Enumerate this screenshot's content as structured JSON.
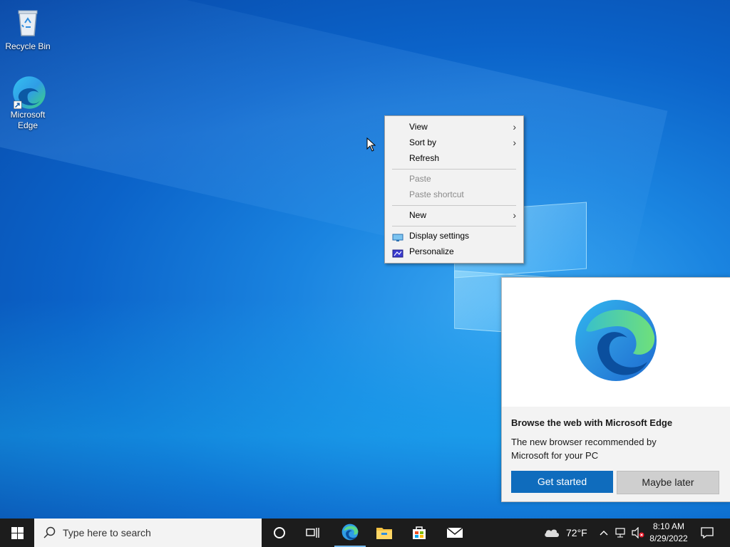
{
  "desktop": {
    "icons": [
      {
        "label": "Recycle Bin"
      },
      {
        "label": "Microsoft Edge"
      }
    ]
  },
  "context_menu": {
    "items": [
      {
        "label": "View",
        "has_submenu": true,
        "enabled": true
      },
      {
        "label": "Sort by",
        "has_submenu": true,
        "enabled": true
      },
      {
        "label": "Refresh",
        "enabled": true
      },
      {
        "label": "Paste",
        "enabled": false
      },
      {
        "label": "Paste shortcut",
        "enabled": false
      },
      {
        "label": "New",
        "has_submenu": true,
        "enabled": true
      },
      {
        "label": "Display settings",
        "icon": "display-icon",
        "enabled": true
      },
      {
        "label": "Personalize",
        "icon": "personalize-icon",
        "enabled": true
      }
    ]
  },
  "edge_promo": {
    "title": "Browse the web with Microsoft Edge",
    "description": "The new browser recommended by Microsoft for your PC",
    "primary_button": "Get started",
    "secondary_button": "Maybe later"
  },
  "taskbar": {
    "search_placeholder": "Type here to search",
    "pinned": [
      "edge-icon",
      "file-explorer-icon",
      "store-icon",
      "mail-icon"
    ],
    "weather": {
      "temp": "72°F",
      "icon": "cloud-icon"
    },
    "clock": {
      "time": "8:10 AM",
      "date": "8/29/2022"
    }
  },
  "colors": {
    "accent": "#0f6cbd",
    "taskbar": "#1c1c1c",
    "menu_bg": "#f2f2f2"
  }
}
